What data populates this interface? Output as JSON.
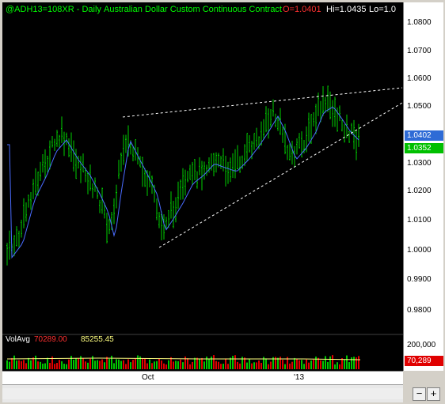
{
  "header": {
    "symbol": "@ADH13=108XR - Daily",
    "description": "Australian Dollar Custom Continuous Contract",
    "open_text": "O=1.0401",
    "high_text": "Hi=1.0435",
    "low_text": "Lo=1.0"
  },
  "price_axis": {
    "labels": [
      "1.0800",
      "1.0700",
      "1.0600",
      "1.0500",
      "1.0300",
      "1.0200",
      "1.0100",
      "1.0000",
      "0.9900",
      "0.9800"
    ],
    "last_price_badge": "1.0402",
    "close_badge": "1.0352"
  },
  "volume_panel": {
    "label": "VolAvg",
    "value_1": "70289.00",
    "value_2": "85255.45",
    "axis_label": "200,000",
    "last_volume_badge": "70,289"
  },
  "date_axis": {
    "labels": [
      "Oct",
      "'13"
    ]
  },
  "scrollbar": {
    "zoom_out": "−",
    "zoom_in": "+"
  },
  "colors": {
    "background": "#000000",
    "price_bars": "#00d000",
    "moving_average": "#4a6cff",
    "trendline": "#ffffff",
    "volume_up": "#00c800",
    "volume_down": "#e00000",
    "symbol_text": "#00ff00",
    "open_text": "#ff3030",
    "badge_blue": "#2e6bd6",
    "badge_green": "#00c000",
    "badge_red": "#e00000"
  }
}
